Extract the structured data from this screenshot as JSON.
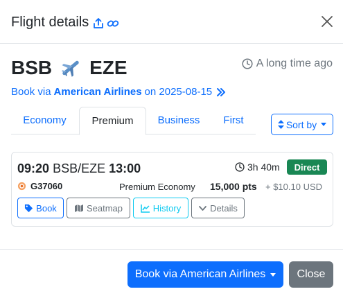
{
  "modal": {
    "title": "Flight details",
    "close_label": "×"
  },
  "route": {
    "origin": "BSB",
    "destination": "EZE",
    "time_ago": "A long time ago"
  },
  "book_via": {
    "prefix": "Book via",
    "airline": "American Airlines",
    "date_text": "on 2025-08-15"
  },
  "tabs": [
    {
      "label": "Economy",
      "active": false
    },
    {
      "label": "Premium",
      "active": true
    },
    {
      "label": "Business",
      "active": false
    },
    {
      "label": "First",
      "active": false
    }
  ],
  "sort": {
    "label": "Sort by"
  },
  "flight": {
    "depart_time": "09:20",
    "route_code": "BSB/EZE",
    "arrive_time": "13:00",
    "duration": "3h 40m",
    "stops_badge": "Direct",
    "flight_number": "G37060",
    "cabin": "Premium Economy",
    "points": "15,000 pts",
    "fee": "+ $10.10 USD",
    "buttons": {
      "book": "Book",
      "seatmap": "Seatmap",
      "history": "History",
      "details": "Details"
    }
  },
  "footer": {
    "book_label": "Book via American Airlines",
    "close_label": "Close"
  },
  "colors": {
    "primary": "#0d6efd",
    "secondary": "#6c757d",
    "success": "#198754",
    "info": "#0dcaf0"
  }
}
